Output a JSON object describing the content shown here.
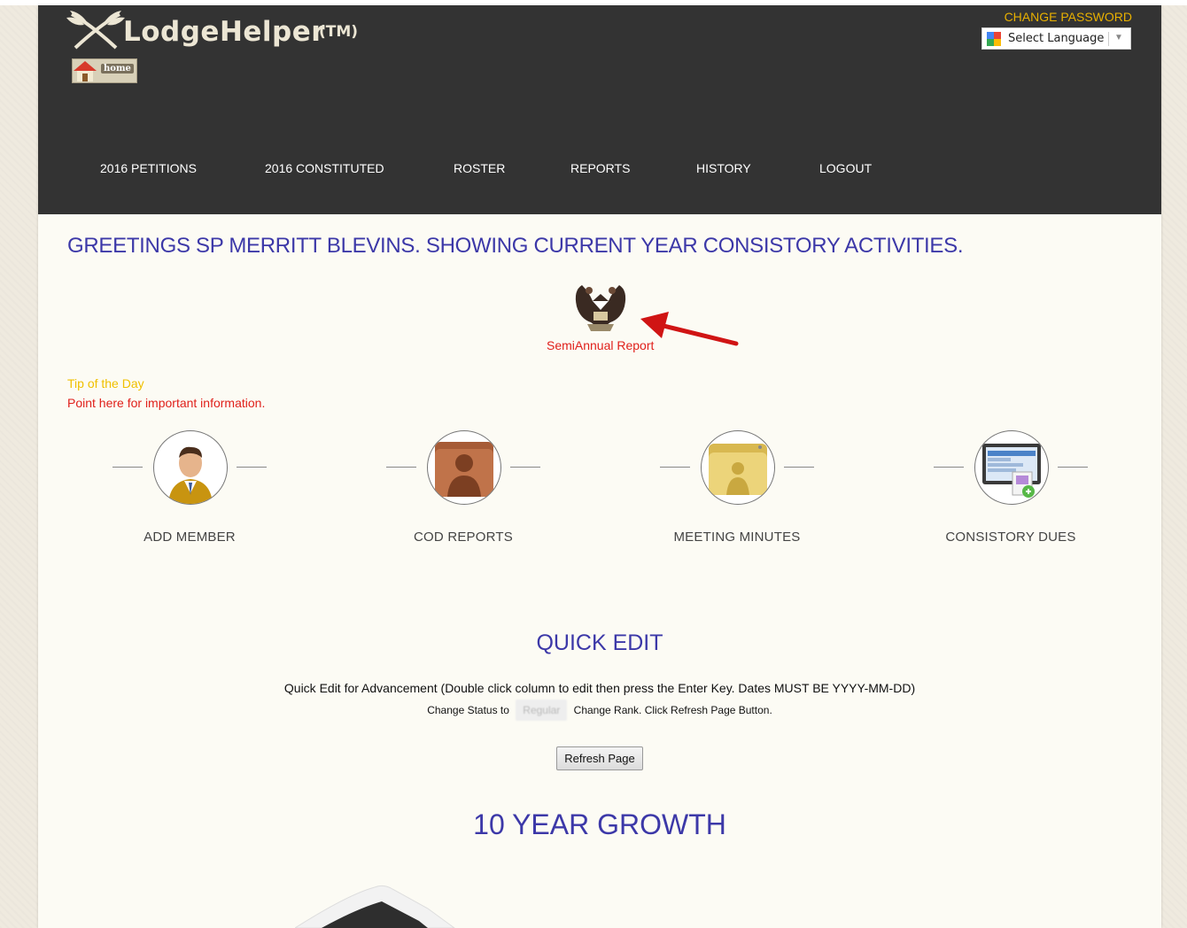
{
  "header": {
    "brand_name": "LodgeHelper",
    "trademark": "(TM)",
    "home_label": "home",
    "change_password": "CHANGE PASSWORD",
    "language_select": "Select Language"
  },
  "nav": {
    "items": [
      "2016 PETITIONS",
      "2016 CONSTITUTED",
      "ROSTER",
      "REPORTS",
      "HISTORY",
      "LOGOUT"
    ]
  },
  "greeting": "GREETINGS SP MERRITT BLEVINS.  SHOWING CURRENT YEAR CONSISTORY ACTIVITIES.",
  "semiannual_report": "SemiAnnual Report",
  "tip": {
    "title": "Tip of the Day",
    "text": "Point here for important information."
  },
  "features": [
    {
      "label": "ADD MEMBER",
      "icon": "person-icon"
    },
    {
      "label": "COD REPORTS",
      "icon": "folder-person-icon"
    },
    {
      "label": "MEETING MINUTES",
      "icon": "folder-icon"
    },
    {
      "label": "CONSISTORY DUES",
      "icon": "computer-icon"
    }
  ],
  "quick_edit": {
    "title": "QUICK EDIT",
    "description": "Quick Edit for Advancement (Double click column to edit then press the Enter Key. Dates MUST BE YYYY-MM-DD)",
    "status_prefix": "Change Status to",
    "status_value": "Regular",
    "status_suffix": "Change Rank.  Click Refresh Page Button.",
    "refresh_button": "Refresh Page"
  },
  "growth_title": "10 YEAR GROWTH",
  "colors": {
    "header_bg": "#333333",
    "page_bg": "#fcfbf4",
    "title_blue": "#3c38a8",
    "accent_red": "#e0201b",
    "accent_yellow": "#e8b000"
  }
}
